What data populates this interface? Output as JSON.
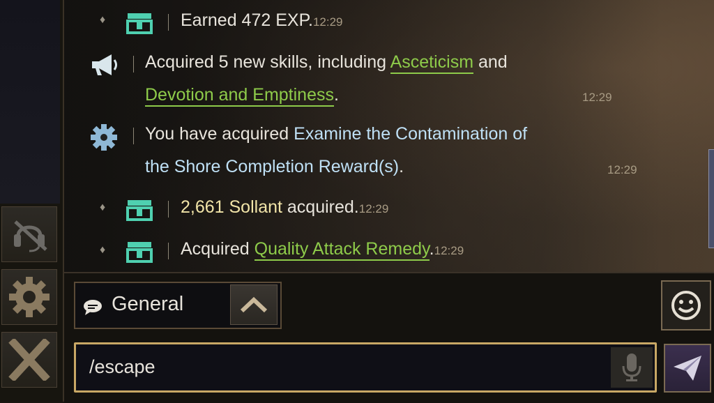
{
  "chat": {
    "messages": [
      {
        "icon": "treasure-chest-icon",
        "text": "Earned 472 EXP.",
        "time": "12:29"
      },
      {
        "icon": "megaphone-icon",
        "prefix": "Acquired 5 new skills, including ",
        "link1": "Asceticism",
        "mid": " and",
        "link2": "Devotion and Emptiness",
        "suffix": ".",
        "time": "12:29"
      },
      {
        "icon": "gear-icon",
        "prefix": "You have acquired ",
        "highlight_line1": "Examine the Contamination of",
        "highlight_line2": "the Shore Completion Reward(s)",
        "suffix": ".",
        "time": "12:29"
      },
      {
        "icon": "treasure-chest-icon",
        "highlight": "2,661 Sollant",
        "suffix": " acquired.",
        "time": "12:29"
      },
      {
        "icon": "treasure-chest-icon",
        "prefix": "Acquired ",
        "link": "Quality Attack Remedy",
        "suffix": ".",
        "time": "12:29"
      }
    ]
  },
  "channel": {
    "label": "General",
    "icon": "speech-bubble-icon"
  },
  "input": {
    "value": "/escape"
  },
  "sidebar": {
    "buttons": [
      "headset-muted-icon",
      "gear-icon",
      "close-x-icon"
    ]
  },
  "colors": {
    "link_green": "#8ecb4a",
    "highlight_blue": "#bfe0f5",
    "highlight_yellow": "#f1e4a8",
    "input_border_gold": "#c9a865",
    "chest_teal": "#4fd0b0"
  }
}
